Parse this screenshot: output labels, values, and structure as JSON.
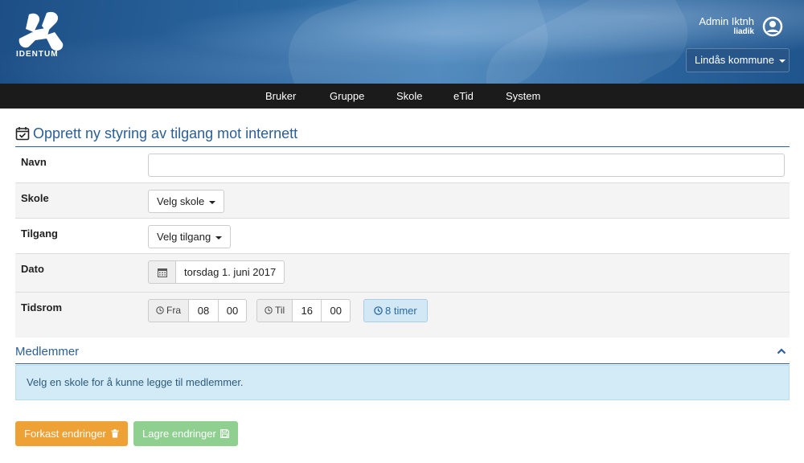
{
  "header": {
    "logo_text": "IDENTUM",
    "user_name": "Admin Iktnh",
    "user_login": "liadik",
    "kommune_label": "Lindås kommune"
  },
  "nav": {
    "items": [
      "Bruker",
      "Gruppe",
      "Skole",
      "eTid",
      "System"
    ]
  },
  "page": {
    "title": "Opprett ny styring av tilgang mot internett"
  },
  "form": {
    "name_label": "Navn",
    "name_value": "",
    "school_label": "Skole",
    "school_select": "Velg skole",
    "access_label": "Tilgang",
    "access_select": "Velg tilgang",
    "date_label": "Dato",
    "date_value": "torsdag 1. juni 2017",
    "time_label": "Tidsrom",
    "from_label": "Fra",
    "from_hour": "08",
    "from_minute": "00",
    "to_label": "Til",
    "to_hour": "16",
    "to_minute": "00",
    "duration": "8 timer"
  },
  "members": {
    "title": "Medlemmer",
    "info": "Velg en skole for å kunne legge til medlemmer."
  },
  "actions": {
    "discard": "Forkast endringer",
    "save": "Lagre endringer"
  },
  "colors": {
    "header_blue": "#2b679f",
    "accent_blue": "#2b5f95",
    "discard_orange": "#eea236",
    "save_green": "#8fcf8f",
    "info_bg": "#d3ebf6"
  }
}
